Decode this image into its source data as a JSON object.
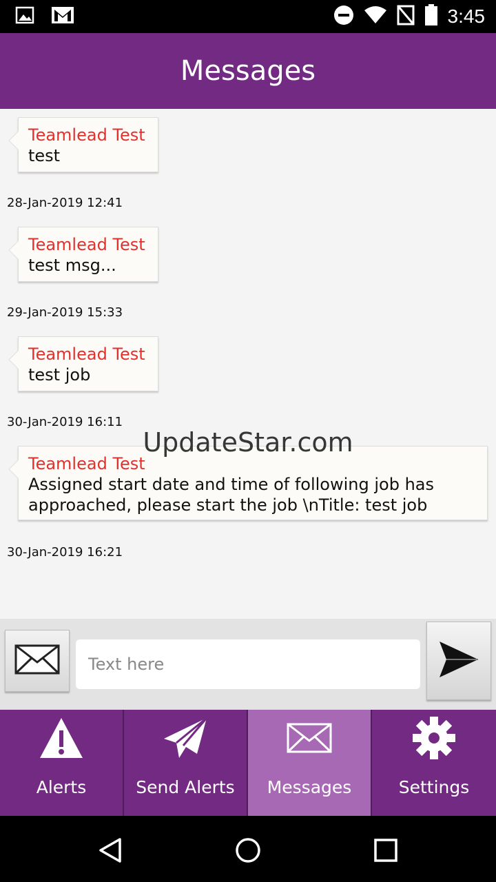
{
  "status_bar": {
    "time": "3:45",
    "icons": [
      "image-icon",
      "gmail-icon",
      "do-not-disturb-icon",
      "wifi-icon",
      "no-sim-icon",
      "battery-icon"
    ]
  },
  "app_bar": {
    "title": "Messages"
  },
  "messages": [
    {
      "sender": "Teamlead Test",
      "body": "test",
      "timestamp": "28-Jan-2019 12:41"
    },
    {
      "sender": "Teamlead Test",
      "body": "test msg...",
      "timestamp": "29-Jan-2019 15:33"
    },
    {
      "sender": "Teamlead Test",
      "body": "test job",
      "timestamp": "30-Jan-2019 16:11"
    },
    {
      "sender": "Teamlead Test",
      "body": "Assigned start date and time of following job has approached, please start the job \\nTitle: test job",
      "timestamp": "30-Jan-2019 16:21"
    }
  ],
  "watermark": "UpdateStar.com",
  "compose": {
    "placeholder": "Text here",
    "value": ""
  },
  "tabs": [
    {
      "label": "Alerts",
      "icon": "alert-icon",
      "active": false
    },
    {
      "label": "Send Alerts",
      "icon": "paper-plane-icon",
      "active": false
    },
    {
      "label": "Messages",
      "icon": "envelope-icon",
      "active": true
    },
    {
      "label": "Settings",
      "icon": "gear-icon",
      "active": false
    }
  ],
  "colors": {
    "primary": "#722a83",
    "active_tab": "#a769b3",
    "sender_red": "#e2302c"
  }
}
